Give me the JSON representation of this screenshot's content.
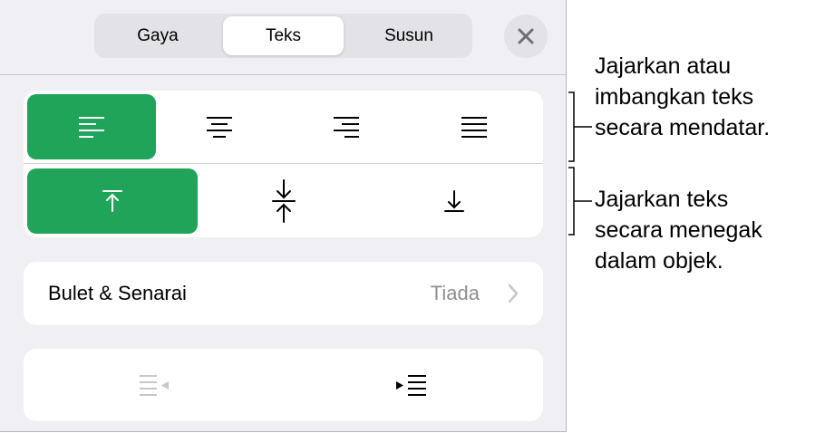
{
  "tabs": [
    {
      "label": "Gaya",
      "active": false
    },
    {
      "label": "Teks",
      "active": true
    },
    {
      "label": "Susun",
      "active": false
    }
  ],
  "close_icon": "close-icon",
  "horizontal_alignment": {
    "options": [
      "align-left-icon",
      "align-center-icon",
      "align-right-icon",
      "justify-icon"
    ],
    "selected": "align-left-icon"
  },
  "vertical_alignment": {
    "options": [
      "align-top-icon",
      "align-middle-icon",
      "align-bottom-icon"
    ],
    "selected": "align-top-icon"
  },
  "bullets_row": {
    "label": "Bulet & Senarai",
    "value": "Tiada"
  },
  "indent": {
    "decrease": {
      "icon": "decrease-indent-icon",
      "enabled": false
    },
    "increase": {
      "icon": "increase-indent-icon",
      "enabled": true
    }
  },
  "annotations": {
    "horizontal": [
      "Jajarkan atau",
      "imbangkan teks",
      "secara mendatar."
    ],
    "vertical": [
      "Jajarkan teks",
      "secara menegak",
      "dalam objek."
    ]
  },
  "colors": {
    "accent": "#1fa45a",
    "panel": "#efeff4",
    "card": "#ffffff",
    "disabled": "#c7c7cc"
  }
}
